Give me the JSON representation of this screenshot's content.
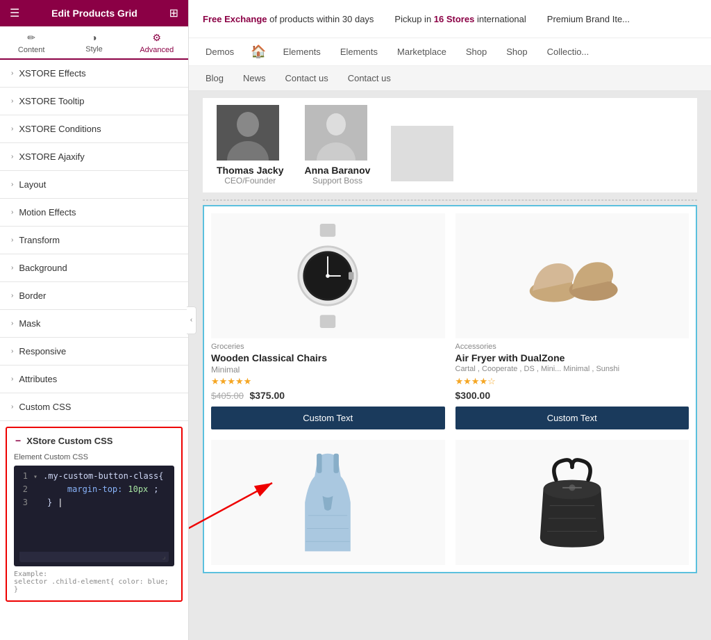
{
  "panel": {
    "title": "Edit Products Grid",
    "tabs": [
      {
        "label": "Content",
        "icon": "✏️",
        "active": false
      },
      {
        "label": "Style",
        "icon": "◑",
        "active": false
      },
      {
        "label": "Advanced",
        "icon": "⚙",
        "active": true
      }
    ],
    "accordion_items": [
      {
        "label": "XSTORE Effects",
        "open": false
      },
      {
        "label": "XSTORE Tooltip",
        "open": false
      },
      {
        "label": "XSTORE Conditions",
        "open": false
      },
      {
        "label": "XSTORE Ajaxify",
        "open": false
      },
      {
        "label": "Layout",
        "open": false
      },
      {
        "label": "Motion Effects",
        "open": false
      },
      {
        "label": "Transform",
        "open": false
      },
      {
        "label": "Background",
        "open": false
      },
      {
        "label": "Border",
        "open": false
      },
      {
        "label": "Mask",
        "open": false
      },
      {
        "label": "Responsive",
        "open": false
      },
      {
        "label": "Attributes",
        "open": false
      },
      {
        "label": "Custom CSS",
        "open": false
      }
    ],
    "xstore_css": {
      "header": "XStore Custom CSS",
      "body_label": "Element Custom CSS",
      "code_lines": [
        {
          "num": 1,
          "text": ".my-custom-button-class{",
          "arrow": true
        },
        {
          "num": 2,
          "text": "    margin-top: 10px;"
        },
        {
          "num": 3,
          "text": "}"
        }
      ],
      "example": "Example:",
      "example_code": "selector .child-element{ color: blue; }"
    }
  },
  "topbar": {
    "free_exchange": "Free Exchange",
    "free_rest": " of products within 30 days",
    "pickup_prefix": "Pickup in ",
    "pickup_stores": "16 Stores",
    "pickup_suffix": " international",
    "premium": "Premium Brand Ite..."
  },
  "nav": {
    "items": [
      "Demos",
      "Elements",
      "Elements",
      "Marketplace",
      "Shop",
      "Shop",
      "Collectio..."
    ]
  },
  "subnav": {
    "items": [
      "Blog",
      "News",
      "Contact us",
      "Contact us"
    ]
  },
  "team": {
    "members": [
      {
        "name": "Thomas Jacky",
        "role": "CEO/Founder"
      },
      {
        "name": "Anna Baranov",
        "role": "Support Boss"
      }
    ]
  },
  "products": [
    {
      "category": "Groceries",
      "name": "Wooden Classical Chairs",
      "brand": "Minimal",
      "stars": "★★★★★",
      "price_old": "$405.00",
      "price_new": "$375.00",
      "btn": "Custom Text",
      "type": "watch"
    },
    {
      "category": "Accessories",
      "name": "Air Fryer with DualZone",
      "brands": "Cartal , Cooperate , DS , Mini... Minimal , Sunshi",
      "stars": "★★★★☆",
      "price_single": "$300.00",
      "btn": "Custom Text",
      "type": "shoes"
    },
    {
      "category": "",
      "name": "",
      "type": "dress"
    },
    {
      "category": "",
      "name": "",
      "type": "bag"
    }
  ],
  "icons": {
    "hamburger": "☰",
    "grid": "⊞",
    "chevron_right": "›",
    "chevron_left": "‹",
    "chevron_down": "▾",
    "collapse": "‹",
    "pencil": "✏",
    "circle_half": "◑",
    "gear": "⚙",
    "minus": "−",
    "store": "🏠",
    "expand": "▾"
  },
  "colors": {
    "brand": "#8b0045",
    "navy": "#1a3a5c",
    "border_blue": "#5bc0de",
    "red_highlight": "#e00"
  }
}
